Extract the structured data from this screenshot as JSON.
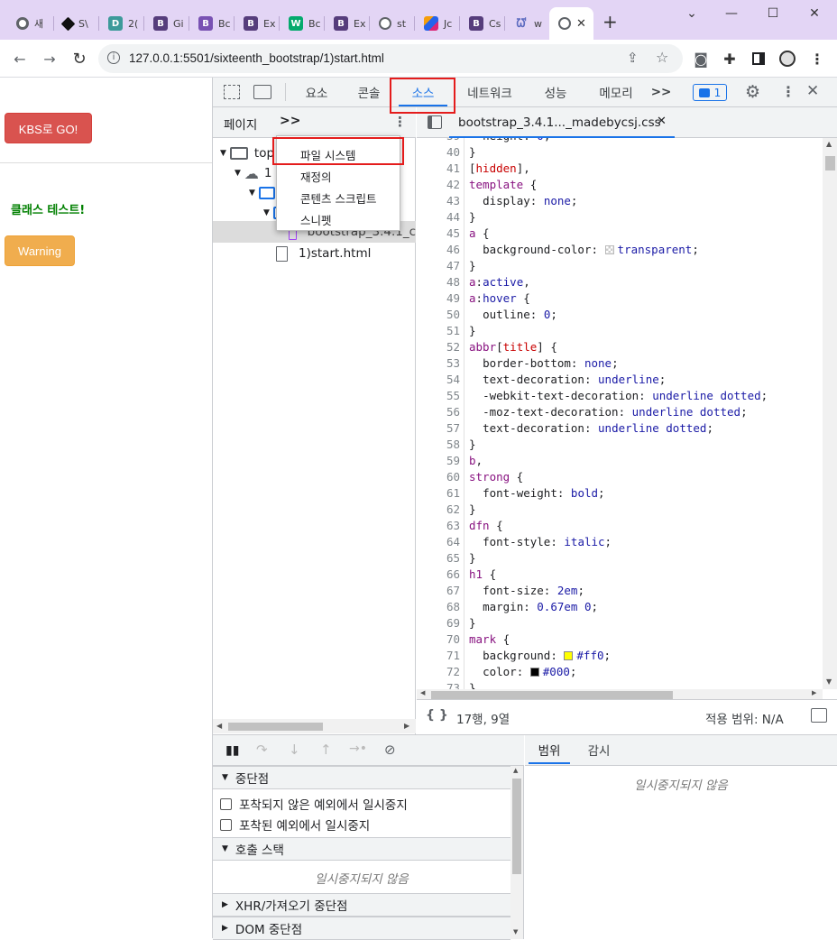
{
  "browser": {
    "tabs": [
      {
        "label": "새",
        "icon": "chrome-icon",
        "color": "#5f6368"
      },
      {
        "label": "S\\",
        "icon": "codepen-icon",
        "color": "#000000"
      },
      {
        "label": "2(",
        "icon": "d-icon",
        "color": "#3d9a9a"
      },
      {
        "label": "Gi",
        "icon": "bootstrap-icon",
        "color": "#563d7c"
      },
      {
        "label": "Bc",
        "icon": "bootstrap-icon",
        "color": "#7952b3"
      },
      {
        "label": "Ex",
        "icon": "bootstrap-icon",
        "color": "#563d7c"
      },
      {
        "label": "Bc",
        "icon": "w3schools-icon",
        "color": "#04aa6d"
      },
      {
        "label": "Ex",
        "icon": "bootstrap-icon",
        "color": "#563d7c"
      },
      {
        "label": "st",
        "icon": "globe-icon",
        "color": "#5f6368"
      },
      {
        "label": "Jc",
        "icon": "jquery-icon",
        "color": "#0769ad"
      },
      {
        "label": "Cs",
        "icon": "bootstrap-icon",
        "color": "#563d7c"
      },
      {
        "label": "w",
        "icon": "w-icon",
        "color": "#5c6bc0"
      },
      {
        "label": "",
        "icon": "globe-icon",
        "color": "#5f6368"
      }
    ],
    "new_tab": "+",
    "url": "127.0.0.1:5501/sixteenth_bootstrap/1)start.html"
  },
  "page": {
    "kbs_button": "KBS로 GO!",
    "class_text": "클래스 테스트!",
    "warning_button": "Warning"
  },
  "devtools": {
    "tabs": [
      "요소",
      "콘솔",
      "소스",
      "네트워크",
      "성능",
      "메모리"
    ],
    "more": ">>",
    "issues_count": "1",
    "navigator": {
      "tab": "페이지",
      "more": ">>",
      "tree": [
        {
          "label": "top",
          "icon": "frame-icon"
        },
        {
          "label": "1",
          "icon": "cloud-icon"
        },
        {
          "label": "",
          "icon": "folder-icon"
        },
        {
          "label": "",
          "icon": "folder-icon"
        },
        {
          "label": "bootstrap_3.4.1_c",
          "icon": "file-css-icon"
        },
        {
          "label": "1)start.html",
          "icon": "file-icon"
        }
      ]
    },
    "menu": [
      "파일 시스템",
      "재정의",
      "콘텐츠 스크립트",
      "스니펫"
    ],
    "editor": {
      "file_tab": "bootstrap_3.4.1..._madebycsj.css",
      "lines": [
        {
          "n": "39",
          "code": "  height: 0;"
        },
        {
          "n": "40",
          "code": "}"
        },
        {
          "n": "41",
          "code": "[hidden],"
        },
        {
          "n": "42",
          "code": "template {"
        },
        {
          "n": "43",
          "code": "  display: none;"
        },
        {
          "n": "44",
          "code": "}"
        },
        {
          "n": "45",
          "code": "a {"
        },
        {
          "n": "46",
          "code": "  background-color: transparent;"
        },
        {
          "n": "47",
          "code": "}"
        },
        {
          "n": "48",
          "code": "a:active,"
        },
        {
          "n": "49",
          "code": "a:hover {"
        },
        {
          "n": "50",
          "code": "  outline: 0;"
        },
        {
          "n": "51",
          "code": "}"
        },
        {
          "n": "52",
          "code": "abbr[title] {"
        },
        {
          "n": "53",
          "code": "  border-bottom: none;"
        },
        {
          "n": "54",
          "code": "  text-decoration: underline;"
        },
        {
          "n": "55",
          "code": "  -webkit-text-decoration: underline dotted;"
        },
        {
          "n": "56",
          "code": "  -moz-text-decoration: underline dotted;"
        },
        {
          "n": "57",
          "code": "  text-decoration: underline dotted;"
        },
        {
          "n": "58",
          "code": "}"
        },
        {
          "n": "59",
          "code": "b,"
        },
        {
          "n": "60",
          "code": "strong {"
        },
        {
          "n": "61",
          "code": "  font-weight: bold;"
        },
        {
          "n": "62",
          "code": "}"
        },
        {
          "n": "63",
          "code": "dfn {"
        },
        {
          "n": "64",
          "code": "  font-style: italic;"
        },
        {
          "n": "65",
          "code": "}"
        },
        {
          "n": "66",
          "code": "h1 {"
        },
        {
          "n": "67",
          "code": "  font-size: 2em;"
        },
        {
          "n": "68",
          "code": "  margin: 0.67em 0;"
        },
        {
          "n": "69",
          "code": "}"
        },
        {
          "n": "70",
          "code": "mark {"
        },
        {
          "n": "71",
          "code": "  background: #ff0;"
        },
        {
          "n": "72",
          "code": "  color: #000;"
        },
        {
          "n": "73",
          "code": "}"
        }
      ],
      "position": "17행, 9열",
      "coverage": "적용 범위: N/A"
    },
    "debugger": {
      "breakpoints_title": "중단점",
      "pause_uncaught": "포착되지 않은 예외에서 일시중지",
      "pause_caught": "포착된 예외에서 일시중지",
      "call_stack_title": "호출 스택",
      "not_paused": "일시중지되지 않음",
      "xhr_title": "XHR/가져오기 중단점",
      "dom_title": "DOM 중단점"
    },
    "scope": {
      "tab_scope": "범위",
      "tab_watch": "감시",
      "not_paused": "일시중지되지 않음"
    }
  },
  "colors": {
    "accent": "#1a73e8",
    "danger": "#d9534f",
    "warning": "#f0ad4e",
    "highlight": "#e41c1c",
    "class_text": "#008000"
  }
}
